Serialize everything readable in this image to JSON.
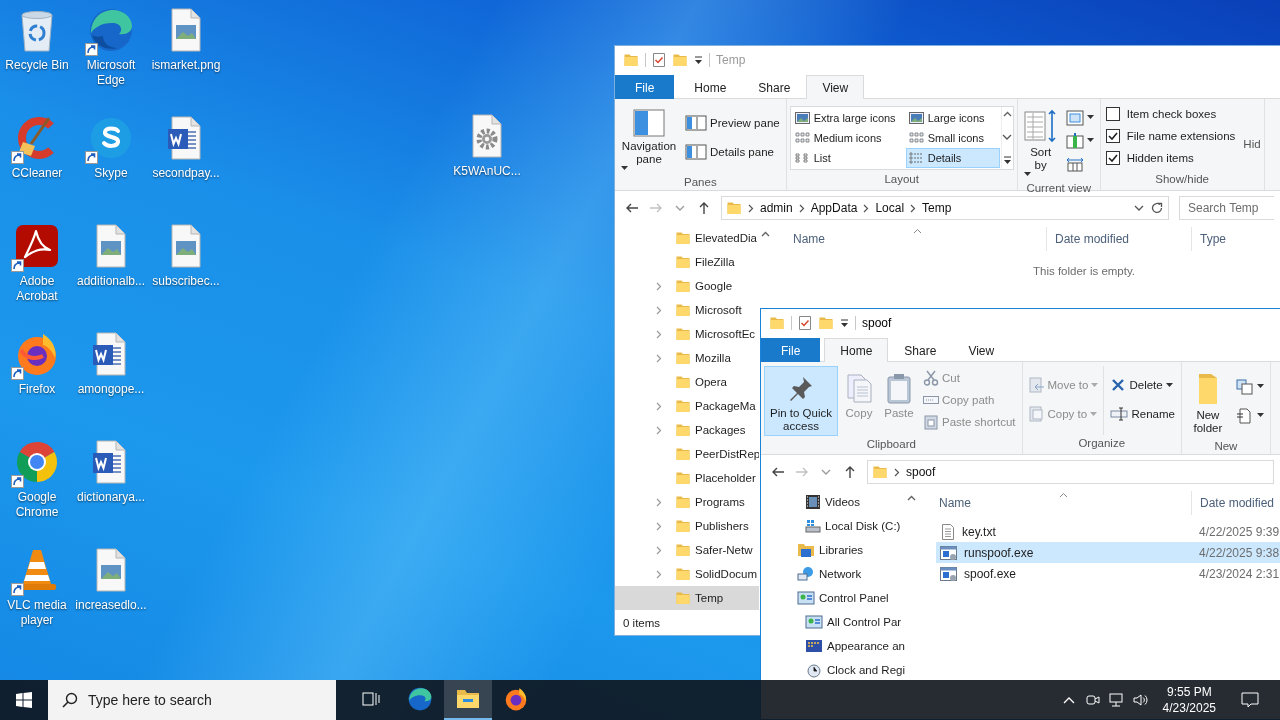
{
  "desktop": {
    "columns": [
      [
        {
          "label": "Recycle Bin",
          "shortcut": false
        },
        {
          "label": "CCleaner",
          "shortcut": true
        },
        {
          "label": "Adobe Acrobat",
          "shortcut": true
        },
        {
          "label": "Firefox",
          "shortcut": true
        },
        {
          "label": "Google Chrome",
          "shortcut": true
        },
        {
          "label": "VLC media player",
          "shortcut": true
        }
      ],
      [
        {
          "label": "Microsoft Edge",
          "shortcut": true
        },
        {
          "label": "Skype",
          "shortcut": true
        },
        {
          "label": "additionalb...",
          "shortcut": false
        },
        {
          "label": "amongope...",
          "shortcut": false
        },
        {
          "label": "dictionarya...",
          "shortcut": false
        },
        {
          "label": "increasedlo...",
          "shortcut": false
        }
      ],
      [
        {
          "label": "ismarket.png",
          "shortcut": false
        },
        {
          "label": "secondpay...",
          "shortcut": false
        },
        {
          "label": "subscribec...",
          "shortcut": false
        }
      ]
    ],
    "loose": [
      {
        "label": "K5WAnUC...",
        "shortcut": false
      }
    ]
  },
  "temp_window": {
    "title": "Temp",
    "active": false,
    "tabs": [
      {
        "label": "File",
        "selected": false
      },
      {
        "label": "Home",
        "selected": false
      },
      {
        "label": "Share",
        "selected": false
      },
      {
        "label": "View",
        "selected": true
      }
    ],
    "ribbon": {
      "panes": {
        "label": "Panes",
        "navigation": "Navigation pane",
        "buttons": [
          "Preview pane",
          "Details pane"
        ]
      },
      "layout": {
        "label": "Layout",
        "options": [
          {
            "label": "Extra large icons",
            "selected": false
          },
          {
            "label": "Large icons",
            "selected": false
          },
          {
            "label": "Medium icons",
            "selected": false
          },
          {
            "label": "Small icons",
            "selected": false
          },
          {
            "label": "List",
            "selected": false
          },
          {
            "label": "Details",
            "selected": true
          }
        ]
      },
      "current_view": {
        "label": "Current view",
        "sort": "Sort by"
      },
      "show_hide": {
        "label": "Show/hide",
        "options": [
          {
            "label": "Item check boxes",
            "checked": false
          },
          {
            "label": "File name extensions",
            "checked": true
          },
          {
            "label": "Hidden items",
            "checked": true
          }
        ],
        "hide": "Hid"
      }
    },
    "path": [
      "admin",
      "AppData",
      "Local",
      "Temp"
    ],
    "search": {
      "placeholder": "Search Temp"
    },
    "tree": [
      {
        "label": "ElevatedDia",
        "has_children": false,
        "selected": false
      },
      {
        "label": "FileZilla",
        "has_children": false,
        "selected": false
      },
      {
        "label": "Google",
        "has_children": true,
        "selected": false
      },
      {
        "label": "Microsoft",
        "has_children": true,
        "selected": false
      },
      {
        "label": "MicrosoftEc",
        "has_children": true,
        "selected": false
      },
      {
        "label": "Mozilla",
        "has_children": true,
        "selected": false
      },
      {
        "label": "Opera",
        "has_children": false,
        "selected": false
      },
      {
        "label": "PackageMa",
        "has_children": true,
        "selected": false
      },
      {
        "label": "Packages",
        "has_children": true,
        "selected": false
      },
      {
        "label": "PeerDistRep",
        "has_children": false,
        "selected": false
      },
      {
        "label": "Placeholder",
        "has_children": false,
        "selected": false
      },
      {
        "label": "Programs",
        "has_children": true,
        "selected": false
      },
      {
        "label": "Publishers",
        "has_children": true,
        "selected": false
      },
      {
        "label": "Safer-Netw",
        "has_children": true,
        "selected": false
      },
      {
        "label": "SolidDocum",
        "has_children": true,
        "selected": false
      },
      {
        "label": "Temp",
        "has_children": false,
        "selected": true
      }
    ],
    "columns": [
      "Name",
      "Date modified",
      "Type"
    ],
    "empty_text": "This folder is empty.",
    "status": "0 items"
  },
  "spoof_window": {
    "title": "spoof",
    "active": true,
    "tabs": [
      {
        "label": "File",
        "selected": false
      },
      {
        "label": "Home",
        "selected": true
      },
      {
        "label": "Share",
        "selected": false
      },
      {
        "label": "View",
        "selected": false
      }
    ],
    "ribbon": {
      "groups": [
        {
          "label": "Clipboard",
          "columns": [
            [
              {
                "kind": "large",
                "label": "Pin to Quick access",
                "highlighted": true,
                "disabled": false,
                "dropdown": false
              }
            ],
            [
              {
                "kind": "large",
                "label": "Copy",
                "highlighted": false,
                "disabled": true,
                "dropdown": false
              }
            ],
            [
              {
                "kind": "large",
                "label": "Paste",
                "highlighted": false,
                "disabled": true,
                "dropdown": false
              }
            ],
            [
              {
                "kind": "small",
                "label": "Cut",
                "highlighted": false,
                "disabled": true,
                "dropdown": false
              },
              {
                "kind": "small",
                "label": "Copy path",
                "highlighted": false,
                "disabled": true,
                "dropdown": false
              },
              {
                "kind": "small",
                "label": "Paste shortcut",
                "highlighted": false,
                "disabled": true,
                "dropdown": false
              }
            ]
          ]
        },
        {
          "label": "Organize",
          "columns": [
            [
              {
                "kind": "small",
                "label": "Move to",
                "highlighted": false,
                "disabled": true,
                "dropdown": true
              },
              {
                "kind": "small",
                "label": "Copy to",
                "highlighted": false,
                "disabled": true,
                "dropdown": true
              }
            ],
            [
              {
                "kind": "small",
                "label": "Delete",
                "highlighted": false,
                "disabled": false,
                "dropdown": true
              },
              {
                "kind": "small",
                "label": "Rename",
                "highlighted": false,
                "disabled": false,
                "dropdown": false
              }
            ]
          ]
        },
        {
          "label": "New",
          "columns": [
            [
              {
                "kind": "large",
                "label": "New folder",
                "highlighted": false,
                "disabled": false,
                "dropdown": false
              }
            ],
            [
              {
                "kind": "icon",
                "highlighted": false,
                "disabled": false,
                "dropdown": true
              },
              {
                "kind": "icon",
                "highlighted": false,
                "disabled": false,
                "dropdown": true
              }
            ]
          ]
        }
      ]
    },
    "path": [
      "spoof"
    ],
    "tree": [
      {
        "children": [
          {
            "label": "Videos"
          },
          {
            "label": "Local Disk (C:)"
          }
        ]
      },
      {
        "label": "Libraries"
      },
      {
        "label": "Network"
      },
      {
        "label": "Control Panel",
        "children": [
          {
            "label": "All Control Par"
          },
          {
            "label": "Appearance an"
          },
          {
            "label": "Clock and Regi"
          }
        ]
      }
    ],
    "columns": [
      "Name",
      "Date modified"
    ],
    "files": [
      {
        "name": "key.txt",
        "date": "4/22/2025 9:39",
        "selected": false
      },
      {
        "name": "runspoof.exe",
        "date": "4/22/2025 9:38",
        "selected": true
      },
      {
        "name": "spoof.exe",
        "date": "4/23/2024 2:31",
        "selected": false
      }
    ]
  },
  "taskbar": {
    "search": {
      "placeholder": "Type here to search"
    },
    "apps": [
      {
        "selected": false
      },
      {
        "selected": false
      },
      {
        "selected": true
      },
      {
        "selected": false
      }
    ],
    "clock": {
      "time": "9:55 PM",
      "date": "4/23/2025"
    }
  }
}
